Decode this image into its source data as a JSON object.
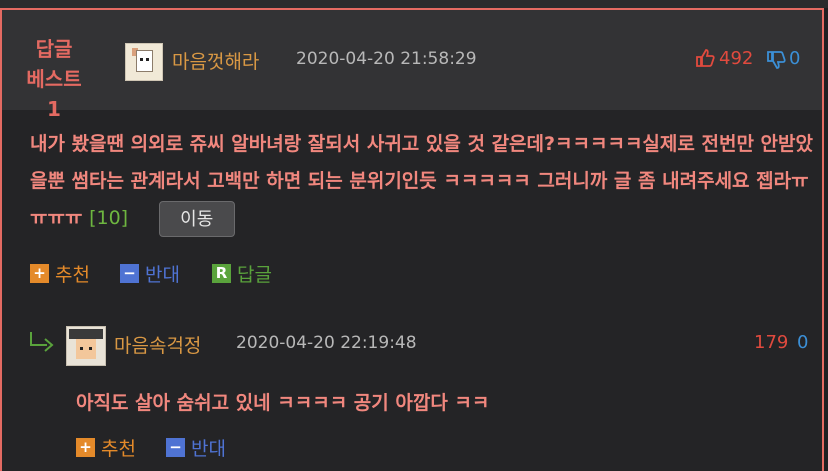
{
  "post": {
    "badge_line1": "답글",
    "badge_line2": "베스트1",
    "nickname": "마음껏해라",
    "timestamp": "2020-04-20 21:58:29",
    "upvotes": "492",
    "downvotes": "0",
    "body": "내가 봤을땐 의외로 쥬씨 알바녀랑 잘되서 사귀고 있을 것 같은데?ㅋㅋㅋㅋㅋ실제로 전번만 안받았을뿐 썸타는 관계라서 고백만 하면 되는 분위기인듯 ㅋㅋㅋㅋㅋ 그러니까 글 좀 내려주세요 젭라ㅠㅠㅠㅠ",
    "reply_count": "[10]",
    "move_button": "이동",
    "actions": {
      "recommend": "추천",
      "oppose": "반대",
      "reply": "답글",
      "reply_icon_letter": "R"
    }
  },
  "reply": {
    "nickname": "마음속걱정",
    "timestamp": "2020-04-20 22:19:48",
    "upvotes": "179",
    "downvotes": "0",
    "body": "아직도 살아 숨쉬고 있네 ㅋㅋㅋㅋ 공기 아깝다 ㅋㅋ",
    "actions": {
      "recommend": "추천",
      "oppose": "반대"
    }
  },
  "colors": {
    "accent": "#e46a62",
    "nickname": "#d99844",
    "upvote": "#e14a3e",
    "downvote": "#3b8fd6"
  },
  "icons": [
    "thumbs-up-icon",
    "thumbs-down-icon",
    "plus-icon",
    "minus-icon",
    "reply-icon",
    "reply-arrow-icon"
  ]
}
